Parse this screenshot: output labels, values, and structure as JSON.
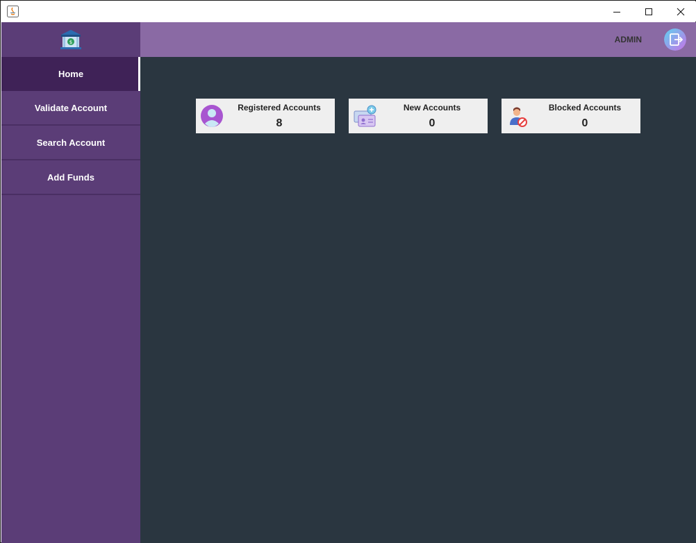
{
  "window": {
    "controls": [
      "minimize",
      "maximize",
      "close"
    ]
  },
  "header": {
    "user_label": "ADMIN",
    "logout_icon": "logout-icon"
  },
  "sidebar": {
    "logo_icon": "bank-icon",
    "items": [
      {
        "label": "Home",
        "active": true
      },
      {
        "label": "Validate Account",
        "active": false
      },
      {
        "label": "Search Account",
        "active": false
      },
      {
        "label": "Add Funds",
        "active": false
      }
    ]
  },
  "dashboard": {
    "cards": [
      {
        "title": "Registered Accounts",
        "value": "8",
        "icon": "user-avatar-icon"
      },
      {
        "title": "New Accounts",
        "value": "0",
        "icon": "new-accounts-icon"
      },
      {
        "title": "Blocked Accounts",
        "value": "0",
        "icon": "blocked-user-icon"
      }
    ]
  },
  "colors": {
    "sidebar": "#5b3d77",
    "sidebar_active": "#3f2257",
    "header": "#8a6aa4",
    "main": "#2a3640",
    "card": "#efefef"
  }
}
